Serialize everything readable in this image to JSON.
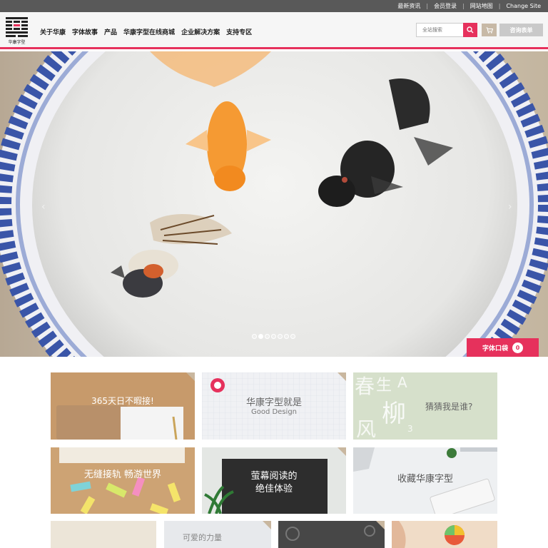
{
  "topbar": {
    "links": [
      "最新资讯",
      "会员登录",
      "网站地图",
      "Change Site"
    ]
  },
  "header": {
    "logo_text": "华康字型",
    "nav": [
      "关于华康",
      "字体故事",
      "产品",
      "华康字型在线商城",
      "企业解决方案",
      "支持专区"
    ],
    "search_placeholder": "全站搜索",
    "quote_label": "咨询表单"
  },
  "hero": {
    "cart_label": "字体口袋",
    "cart_count": "0",
    "dot_count": 7,
    "active_dot": 1
  },
  "tiles": {
    "t1": "365天日不暇接!",
    "t2_line1": "华康字型就是",
    "t2_line2": "Good Design",
    "t3": "猜猜我是谁?",
    "t3_glyphs": [
      "春",
      "生",
      "A",
      "柳",
      "风",
      "3"
    ],
    "t4": "无缝接轨 畅游世界",
    "t5_line1": "萤幕阅读的",
    "t5_line2": "绝佳体验",
    "t6": "收藏华康字型",
    "t8": "可爱的力量"
  },
  "colors": {
    "accent": "#e6315c",
    "topbar": "#595959"
  }
}
